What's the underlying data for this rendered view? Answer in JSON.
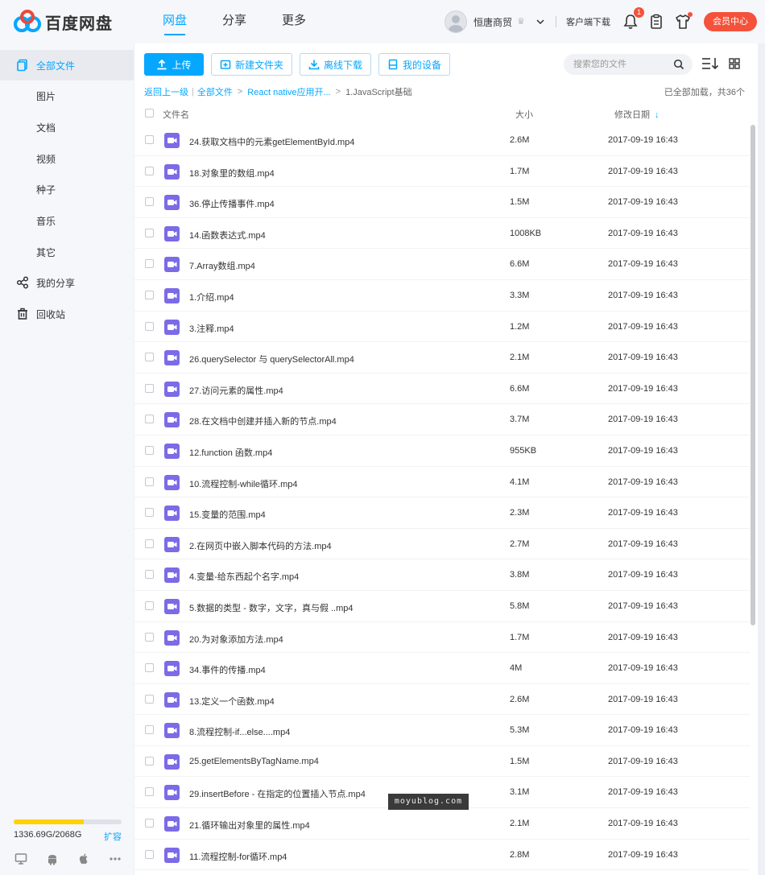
{
  "brand": {
    "name": "百度网盘",
    "logo_color": "#06a7ff"
  },
  "nav": [
    {
      "label": "网盘",
      "active": true
    },
    {
      "label": "分享",
      "active": false
    },
    {
      "label": "更多",
      "active": false
    }
  ],
  "header": {
    "username": "恒唐商贸",
    "client_download": "客户端下载",
    "notification_count": "1",
    "vip_button": "会员中心"
  },
  "sidebar": {
    "items": [
      {
        "label": "全部文件",
        "icon": "files-icon",
        "active": true
      },
      {
        "label": "图片"
      },
      {
        "label": "文档"
      },
      {
        "label": "视频"
      },
      {
        "label": "种子"
      },
      {
        "label": "音乐"
      },
      {
        "label": "其它"
      },
      {
        "label": "我的分享",
        "icon": "share-icon"
      },
      {
        "label": "回收站",
        "icon": "trash-icon"
      }
    ],
    "storage": {
      "used_text": "1336.69G/2068G",
      "used_fraction": 0.646,
      "expand_label": "扩容"
    }
  },
  "toolbar": {
    "upload": "上传",
    "new_folder": "新建文件夹",
    "offline_download": "离线下载",
    "my_devices": "我的设备",
    "search_placeholder": "搜索您的文件"
  },
  "breadcrumb": {
    "back": "返回上一级",
    "items": [
      "全部文件",
      "React native应用开...",
      "1.JavaScript基础"
    ]
  },
  "load_status": "已全部加载，共36个",
  "columns": {
    "name": "文件名",
    "size": "大小",
    "date": "修改日期"
  },
  "files": [
    {
      "name": "24.获取文档中的元素getElementById.mp4",
      "size": "2.6M",
      "date": "2017-09-19 16:43"
    },
    {
      "name": "18.对象里的数组.mp4",
      "size": "1.7M",
      "date": "2017-09-19 16:43"
    },
    {
      "name": "36.停止传播事件.mp4",
      "size": "1.5M",
      "date": "2017-09-19 16:43"
    },
    {
      "name": "14.函数表达式.mp4",
      "size": "1008KB",
      "date": "2017-09-19 16:43"
    },
    {
      "name": "7.Array数组.mp4",
      "size": "6.6M",
      "date": "2017-09-19 16:43"
    },
    {
      "name": "1.介绍.mp4",
      "size": "3.3M",
      "date": "2017-09-19 16:43"
    },
    {
      "name": "3.注释.mp4",
      "size": "1.2M",
      "date": "2017-09-19 16:43"
    },
    {
      "name": "26.querySelector 与 querySelectorAll.mp4",
      "size": "2.1M",
      "date": "2017-09-19 16:43"
    },
    {
      "name": "27.访问元素的属性.mp4",
      "size": "6.6M",
      "date": "2017-09-19 16:43"
    },
    {
      "name": "28.在文档中创建并插入新的节点.mp4",
      "size": "3.7M",
      "date": "2017-09-19 16:43"
    },
    {
      "name": "12.function 函数.mp4",
      "size": "955KB",
      "date": "2017-09-19 16:43"
    },
    {
      "name": "10.流程控制-while循环.mp4",
      "size": "4.1M",
      "date": "2017-09-19 16:43"
    },
    {
      "name": "15.变量的范围.mp4",
      "size": "2.3M",
      "date": "2017-09-19 16:43"
    },
    {
      "name": "2.在网页中嵌入脚本代码的方法.mp4",
      "size": "2.7M",
      "date": "2017-09-19 16:43"
    },
    {
      "name": "4.变量-给东西起个名字.mp4",
      "size": "3.8M",
      "date": "2017-09-19 16:43"
    },
    {
      "name": "5.数据的类型 - 数字，文字，真与假 ..mp4",
      "size": "5.8M",
      "date": "2017-09-19 16:43"
    },
    {
      "name": "20.为对象添加方法.mp4",
      "size": "1.7M",
      "date": "2017-09-19 16:43"
    },
    {
      "name": "34.事件的传播.mp4",
      "size": "4M",
      "date": "2017-09-19 16:43"
    },
    {
      "name": "13.定义一个函数.mp4",
      "size": "2.6M",
      "date": "2017-09-19 16:43"
    },
    {
      "name": "8.流程控制-if...else....mp4",
      "size": "5.3M",
      "date": "2017-09-19 16:43"
    },
    {
      "name": "25.getElementsByTagName.mp4",
      "size": "1.5M",
      "date": "2017-09-19 16:43"
    },
    {
      "name": "29.insertBefore - 在指定的位置插入节点.mp4",
      "size": "3.1M",
      "date": "2017-09-19 16:43"
    },
    {
      "name": "21.循环输出对象里的属性.mp4",
      "size": "2.1M",
      "date": "2017-09-19 16:43"
    },
    {
      "name": "11.流程控制-for循环.mp4",
      "size": "2.8M",
      "date": "2017-09-19 16:43"
    }
  ],
  "watermark": "moyublog.com",
  "colors": {
    "accent": "#06a7ff",
    "video_icon": "#7b6be6",
    "vip": "#f4523b",
    "storage_fill": "#ffd200"
  }
}
